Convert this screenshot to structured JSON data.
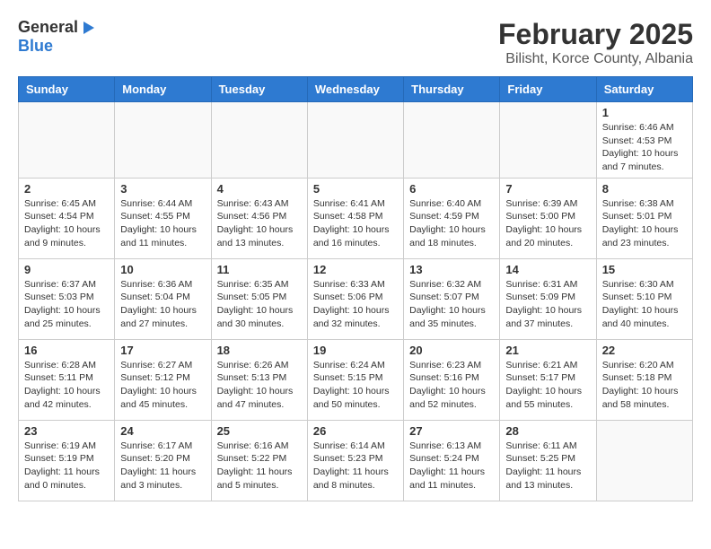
{
  "header": {
    "logo_general": "General",
    "logo_blue": "Blue",
    "month_title": "February 2025",
    "location": "Bilisht, Korce County, Albania"
  },
  "calendar": {
    "days_of_week": [
      "Sunday",
      "Monday",
      "Tuesday",
      "Wednesday",
      "Thursday",
      "Friday",
      "Saturday"
    ],
    "weeks": [
      [
        {
          "day": "",
          "info": ""
        },
        {
          "day": "",
          "info": ""
        },
        {
          "day": "",
          "info": ""
        },
        {
          "day": "",
          "info": ""
        },
        {
          "day": "",
          "info": ""
        },
        {
          "day": "",
          "info": ""
        },
        {
          "day": "1",
          "info": "Sunrise: 6:46 AM\nSunset: 4:53 PM\nDaylight: 10 hours and 7 minutes."
        }
      ],
      [
        {
          "day": "2",
          "info": "Sunrise: 6:45 AM\nSunset: 4:54 PM\nDaylight: 10 hours and 9 minutes."
        },
        {
          "day": "3",
          "info": "Sunrise: 6:44 AM\nSunset: 4:55 PM\nDaylight: 10 hours and 11 minutes."
        },
        {
          "day": "4",
          "info": "Sunrise: 6:43 AM\nSunset: 4:56 PM\nDaylight: 10 hours and 13 minutes."
        },
        {
          "day": "5",
          "info": "Sunrise: 6:41 AM\nSunset: 4:58 PM\nDaylight: 10 hours and 16 minutes."
        },
        {
          "day": "6",
          "info": "Sunrise: 6:40 AM\nSunset: 4:59 PM\nDaylight: 10 hours and 18 minutes."
        },
        {
          "day": "7",
          "info": "Sunrise: 6:39 AM\nSunset: 5:00 PM\nDaylight: 10 hours and 20 minutes."
        },
        {
          "day": "8",
          "info": "Sunrise: 6:38 AM\nSunset: 5:01 PM\nDaylight: 10 hours and 23 minutes."
        }
      ],
      [
        {
          "day": "9",
          "info": "Sunrise: 6:37 AM\nSunset: 5:03 PM\nDaylight: 10 hours and 25 minutes."
        },
        {
          "day": "10",
          "info": "Sunrise: 6:36 AM\nSunset: 5:04 PM\nDaylight: 10 hours and 27 minutes."
        },
        {
          "day": "11",
          "info": "Sunrise: 6:35 AM\nSunset: 5:05 PM\nDaylight: 10 hours and 30 minutes."
        },
        {
          "day": "12",
          "info": "Sunrise: 6:33 AM\nSunset: 5:06 PM\nDaylight: 10 hours and 32 minutes."
        },
        {
          "day": "13",
          "info": "Sunrise: 6:32 AM\nSunset: 5:07 PM\nDaylight: 10 hours and 35 minutes."
        },
        {
          "day": "14",
          "info": "Sunrise: 6:31 AM\nSunset: 5:09 PM\nDaylight: 10 hours and 37 minutes."
        },
        {
          "day": "15",
          "info": "Sunrise: 6:30 AM\nSunset: 5:10 PM\nDaylight: 10 hours and 40 minutes."
        }
      ],
      [
        {
          "day": "16",
          "info": "Sunrise: 6:28 AM\nSunset: 5:11 PM\nDaylight: 10 hours and 42 minutes."
        },
        {
          "day": "17",
          "info": "Sunrise: 6:27 AM\nSunset: 5:12 PM\nDaylight: 10 hours and 45 minutes."
        },
        {
          "day": "18",
          "info": "Sunrise: 6:26 AM\nSunset: 5:13 PM\nDaylight: 10 hours and 47 minutes."
        },
        {
          "day": "19",
          "info": "Sunrise: 6:24 AM\nSunset: 5:15 PM\nDaylight: 10 hours and 50 minutes."
        },
        {
          "day": "20",
          "info": "Sunrise: 6:23 AM\nSunset: 5:16 PM\nDaylight: 10 hours and 52 minutes."
        },
        {
          "day": "21",
          "info": "Sunrise: 6:21 AM\nSunset: 5:17 PM\nDaylight: 10 hours and 55 minutes."
        },
        {
          "day": "22",
          "info": "Sunrise: 6:20 AM\nSunset: 5:18 PM\nDaylight: 10 hours and 58 minutes."
        }
      ],
      [
        {
          "day": "23",
          "info": "Sunrise: 6:19 AM\nSunset: 5:19 PM\nDaylight: 11 hours and 0 minutes."
        },
        {
          "day": "24",
          "info": "Sunrise: 6:17 AM\nSunset: 5:20 PM\nDaylight: 11 hours and 3 minutes."
        },
        {
          "day": "25",
          "info": "Sunrise: 6:16 AM\nSunset: 5:22 PM\nDaylight: 11 hours and 5 minutes."
        },
        {
          "day": "26",
          "info": "Sunrise: 6:14 AM\nSunset: 5:23 PM\nDaylight: 11 hours and 8 minutes."
        },
        {
          "day": "27",
          "info": "Sunrise: 6:13 AM\nSunset: 5:24 PM\nDaylight: 11 hours and 11 minutes."
        },
        {
          "day": "28",
          "info": "Sunrise: 6:11 AM\nSunset: 5:25 PM\nDaylight: 11 hours and 13 minutes."
        },
        {
          "day": "",
          "info": ""
        }
      ]
    ]
  }
}
